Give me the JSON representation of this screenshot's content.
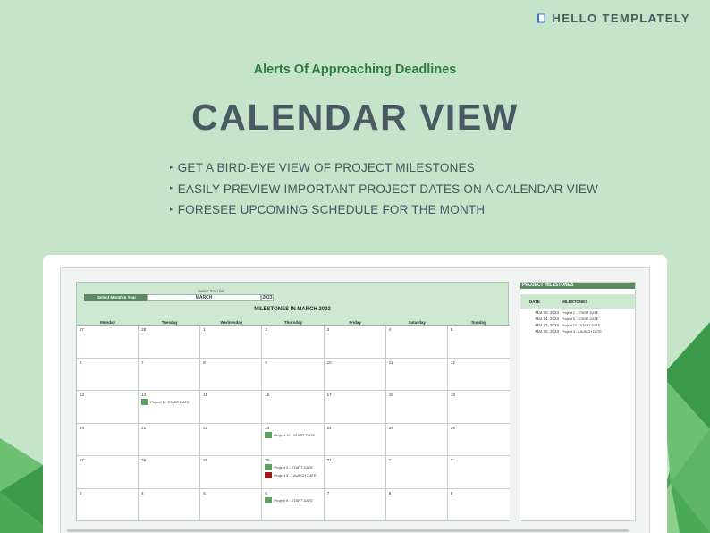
{
  "brand": {
    "name": "HELLO TEMPLATELY",
    "icon": "book-icon",
    "color": "#4b5b62"
  },
  "header": {
    "subtitle": "Alerts Of Approaching Deadlines",
    "title": "CALENDAR VIEW"
  },
  "bullets": [
    "GET A BIRD-EYE VIEW OF PROJECT MILESTONES",
    "EASILY PREVIEW IMPORTANT PROJECT DATES ON A CALENDAR VIEW",
    "FORESEE UPCOMING SCHEDULE FOR THE MONTH"
  ],
  "colors": {
    "background": "#c5e4c9",
    "accent_green": "#2e7d3c",
    "header_green": "#5c8a61",
    "event_green": "#5ea05f",
    "event_red": "#9b1c1c",
    "panel_green": "#cfe8d1"
  },
  "calendar": {
    "select_hint": "Select from list",
    "select_label": "Select Month & Year",
    "month": "MARCH",
    "year": "2023",
    "title": "MILESTONES IN MARCH 2023",
    "days_of_week": [
      "Monday",
      "Tuesday",
      "Wednesday",
      "Thursday",
      "Friday",
      "Saturday",
      "Sunday"
    ],
    "weeks": [
      [
        {
          "day": "27"
        },
        {
          "day": "28"
        },
        {
          "day": "1"
        },
        {
          "day": "2"
        },
        {
          "day": "3"
        },
        {
          "day": "4"
        },
        {
          "day": "5"
        }
      ],
      [
        {
          "day": "6"
        },
        {
          "day": "7"
        },
        {
          "day": "8"
        },
        {
          "day": "9"
        },
        {
          "day": "10"
        },
        {
          "day": "11"
        },
        {
          "day": "12"
        }
      ],
      [
        {
          "day": "13"
        },
        {
          "day": "14",
          "events": [
            {
              "text": "Project 5 - START DATE",
              "color": "#5ea05f"
            }
          ]
        },
        {
          "day": "15"
        },
        {
          "day": "16"
        },
        {
          "day": "17"
        },
        {
          "day": "18"
        },
        {
          "day": "19"
        }
      ],
      [
        {
          "day": "20"
        },
        {
          "day": "21"
        },
        {
          "day": "22"
        },
        {
          "day": "23",
          "events": [
            {
              "text": "Project 10 - START DATE",
              "color": "#5ea05f"
            }
          ]
        },
        {
          "day": "24"
        },
        {
          "day": "25"
        },
        {
          "day": "26"
        }
      ],
      [
        {
          "day": "27"
        },
        {
          "day": "28"
        },
        {
          "day": "29"
        },
        {
          "day": "30",
          "events": [
            {
              "text": "Project 2 - START DATE",
              "color": "#5ea05f"
            },
            {
              "text": "Project 3 - LAUNCH DATE",
              "color": "#9b1c1c"
            }
          ]
        },
        {
          "day": "31"
        },
        {
          "day": "1"
        },
        {
          "day": "2"
        }
      ],
      [
        {
          "day": "3"
        },
        {
          "day": "4"
        },
        {
          "day": "5"
        },
        {
          "day": "6",
          "events": [
            {
              "text": "Project 9 - START DATE",
              "color": "#5ea05f"
            }
          ]
        },
        {
          "day": "7"
        },
        {
          "day": "8"
        },
        {
          "day": "9"
        }
      ]
    ]
  },
  "milestones": {
    "title": "PROJECT MILESTONES",
    "col_date": "DATE",
    "col_milestones": "MILESTONES",
    "rows": [
      {
        "date": "Mar 30, 2023",
        "text": "Project 2 - START DATE"
      },
      {
        "date": "Mar 14, 2023",
        "text": "Project 5 - START DATE"
      },
      {
        "date": "Mar 23, 2023",
        "text": "Project 10 - START DATE"
      },
      {
        "date": "Mar 30, 2023",
        "text": "Project 3 - LAUNCH DATE"
      }
    ]
  }
}
